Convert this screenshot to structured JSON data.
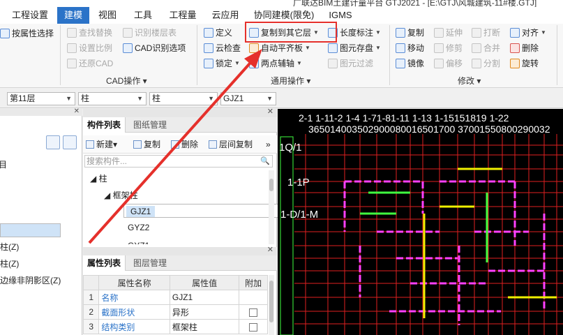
{
  "window": {
    "title": "广联达BIM土建计量平台 GTJ2021 - [E:\\GTJ\\风城建筑-11#楼.GTJ]"
  },
  "menu": {
    "tabs": [
      {
        "label": "工程设置"
      },
      {
        "label": "建模"
      },
      {
        "label": "视图"
      },
      {
        "label": "工具"
      },
      {
        "label": "工程量"
      },
      {
        "label": "云应用"
      },
      {
        "label": "协同建模(限免)"
      },
      {
        "label": "IGMS"
      }
    ],
    "active": "建模"
  },
  "ribbon": {
    "select_group": {
      "by_attr": "按属性选择"
    },
    "cad_group": {
      "label": "CAD操作",
      "find_replace": "查找替换",
      "set_scale": "设置比例",
      "restore_cad": "还原CAD",
      "identify_floor": "识别楼层表",
      "cad_options": "CAD识别选项"
    },
    "general_group": {
      "label": "通用操作",
      "define": "定义",
      "cloud_check": "云检查",
      "lock": "锁定",
      "copy_to_floor": "复制到其它层",
      "auto_align": "自动平齐板",
      "two_point_aux": "两点辅轴",
      "length_dim": "长度标注",
      "save_element": "图元存盘",
      "element_filter": "图元过滤"
    },
    "modify_group": {
      "label": "修改",
      "copy": "复制",
      "move": "移动",
      "mirror": "镜像",
      "extend": "延伸",
      "trim": "修剪",
      "offset": "偏移",
      "break": "打断",
      "merge": "合并",
      "split": "分割",
      "align": "对齐",
      "delete": "删除",
      "rotate": "旋转"
    }
  },
  "selectors": {
    "floor": "第11层",
    "category": "柱",
    "type": "柱",
    "component": "GJZ1"
  },
  "left_panel": {
    "items": [
      {
        "label": "柱(Z)"
      },
      {
        "label": "柱(Z)"
      },
      {
        "label": "边缘非阴影区(Z)"
      }
    ]
  },
  "component_list": {
    "tabs": [
      {
        "label": "构件列表"
      },
      {
        "label": "图纸管理"
      }
    ],
    "toolbar": {
      "new": "新建",
      "copy": "复制",
      "delete": "删除",
      "floor_copy": "层间复制"
    },
    "search_placeholder": "搜索构件...",
    "tree": {
      "root": "柱",
      "group": "框架柱",
      "items": [
        {
          "label": "GJZ1"
        },
        {
          "label": "GYZ2"
        },
        {
          "label": "GYZ1"
        }
      ]
    }
  },
  "property_list": {
    "tabs": [
      {
        "label": "属性列表"
      },
      {
        "label": "图层管理"
      }
    ],
    "headers": {
      "name": "属性名称",
      "value": "属性值",
      "attach": "附加"
    },
    "rows": [
      {
        "no": "1",
        "name": "名称",
        "value": "GJZ1"
      },
      {
        "no": "2",
        "name": "截面形状",
        "value": "异形"
      },
      {
        "no": "3",
        "name": "结构类别",
        "value": "框架柱"
      }
    ]
  },
  "canvas": {
    "top_axis_labels": "2-1  1-11-2  1-4  1-71-81-11  1-13  1-15151819 1-22",
    "top_dims": "365014003502900080016501700 37001550800290032",
    "left_axis": [
      {
        "label": "1Q/1"
      },
      {
        "label": "1-1P"
      },
      {
        "label": "1-D/1-M"
      }
    ],
    "colors": {
      "background": "#000000",
      "grid": "#e02020",
      "wall": "#ff40ff",
      "beam": "#f0f000",
      "col": "#40ff40"
    }
  }
}
